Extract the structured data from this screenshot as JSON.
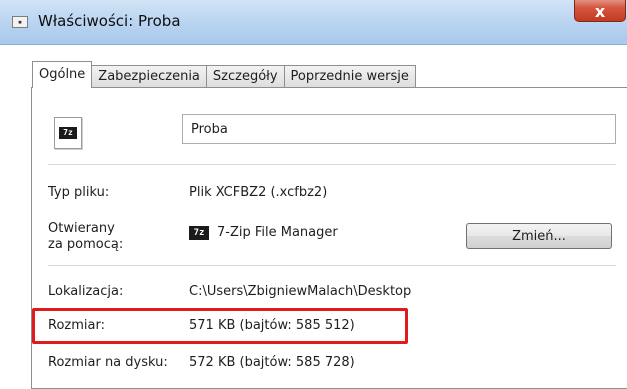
{
  "window": {
    "title": "Właściwości: Proba",
    "title_icon": "file-properties-icon",
    "close_label": "x"
  },
  "tabs": [
    {
      "label": "Ogólne",
      "active": true
    },
    {
      "label": "Zabezpieczenia",
      "active": false
    },
    {
      "label": "Szczegóły",
      "active": false
    },
    {
      "label": "Poprzednie wersje",
      "active": false
    }
  ],
  "general": {
    "file_icon_badge": "7z",
    "file_name": "Proba",
    "type_label": "Typ pliku:",
    "type_value": "Plik XCFBZ2 (.xcfbz2)",
    "opens_with_label_line1": "Otwierany",
    "opens_with_label_line2": "za pomocą:",
    "opens_with_app_badge": "7z",
    "opens_with_value": "7-Zip File Manager",
    "change_button": "Zmień...",
    "location_label": "Lokalizacja:",
    "location_value": "C:\\Users\\ZbigniewMalach\\Desktop",
    "size_label": "Rozmiar:",
    "size_value": "571 KB (bajtów: 585 512)",
    "size_on_disk_label": "Rozmiar na dysku:",
    "size_on_disk_value": "572 KB (bajtów: 585 728)"
  },
  "colors": {
    "highlight_border": "#e01b1b",
    "titlebar": "#bcd6f2",
    "close_button": "#d5563f"
  }
}
